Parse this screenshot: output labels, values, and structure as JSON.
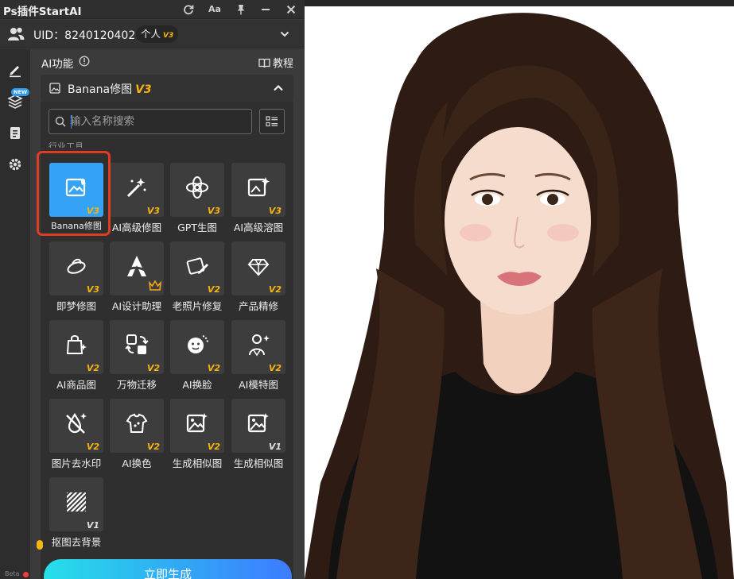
{
  "window": {
    "title": "Ps插件StartAI",
    "font_button": "Aa"
  },
  "user": {
    "uid_text": "UID：8240120402",
    "plan": "个人",
    "plan_version": "V3"
  },
  "sidebar": {
    "new_tag": "NEW",
    "beta": "Beta"
  },
  "section": {
    "label": "AI功能",
    "tutorial": "教程"
  },
  "feature": {
    "name": "Banana修图",
    "version": "V3"
  },
  "search": {
    "placeholder": "输入名称搜索",
    "value": ""
  },
  "category_label": "行业工具",
  "tools": [
    {
      "label": "Banana修图",
      "version": "V3",
      "icon": "image-edit-icon",
      "selected": true
    },
    {
      "label": "AI高级修图",
      "version": "V3",
      "icon": "magic-wand-icon"
    },
    {
      "label": "GPT生图",
      "version": "V3",
      "icon": "openai-knot-icon"
    },
    {
      "label": "AI高级溶图",
      "version": "V3",
      "icon": "image-sparkle-icon"
    },
    {
      "label": "即梦修图",
      "version": "V3",
      "icon": "dream-icon"
    },
    {
      "label": "AI设计助理",
      "version": "",
      "icon": "design-assistant-icon",
      "crown": true
    },
    {
      "label": "老照片修复",
      "version": "V2",
      "icon": "photo-repair-icon"
    },
    {
      "label": "产品精修",
      "version": "V2",
      "icon": "diamond-icon"
    },
    {
      "label": "AI商品图",
      "version": "V2",
      "icon": "shopping-bag-icon"
    },
    {
      "label": "万物迁移",
      "version": "V2",
      "icon": "transfer-icon"
    },
    {
      "label": "AI换脸",
      "version": "V2",
      "icon": "face-swap-icon"
    },
    {
      "label": "AI模特图",
      "version": "V2",
      "icon": "model-icon"
    },
    {
      "label": "图片去水印",
      "version": "V2",
      "icon": "remove-watermark-icon"
    },
    {
      "label": "AI换色",
      "version": "V2",
      "icon": "recolor-icon"
    },
    {
      "label": "生成相似图",
      "version": "V2",
      "icon": "similar-image-icon"
    },
    {
      "label": "生成相似图",
      "version": "V1",
      "icon": "similar-image-icon"
    },
    {
      "label": "抠图去背景",
      "version": "V1",
      "icon": "remove-background-icon"
    }
  ],
  "action": {
    "generate_label": "立即生成"
  },
  "colors": {
    "accent": "#35a3f5",
    "version_badge": "#f5b50e",
    "highlight": "#e03c22",
    "panel_bg": "#3b3b3b"
  }
}
